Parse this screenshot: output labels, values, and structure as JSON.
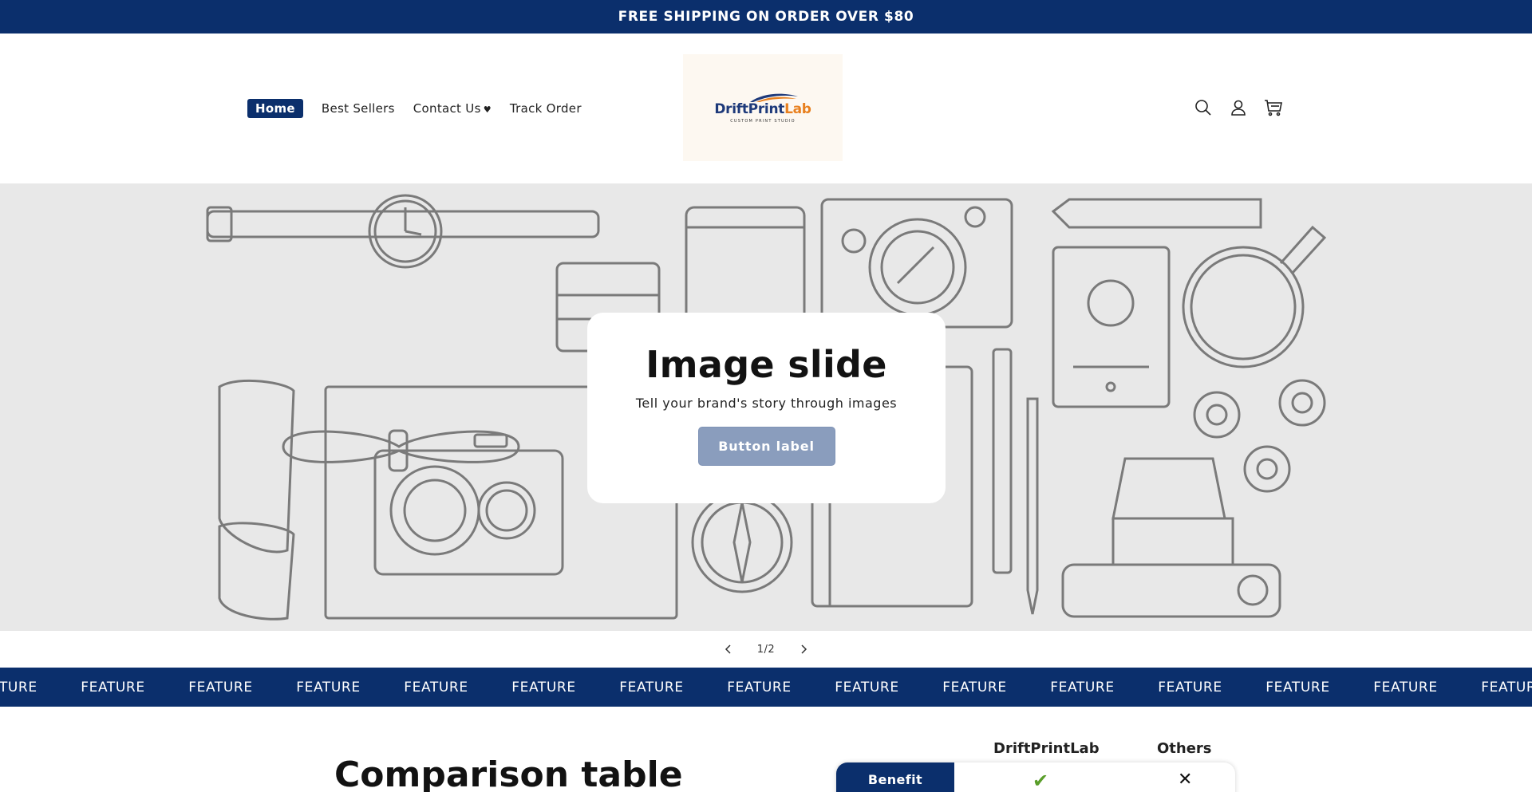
{
  "announcement": {
    "text": "FREE SHIPPING ON ORDER OVER $80"
  },
  "header": {
    "nav": [
      {
        "label": "Home",
        "active": true
      },
      {
        "label": "Best Sellers"
      },
      {
        "label": "Contact Us"
      },
      {
        "label": "Track Order"
      }
    ],
    "logo": {
      "word_primary": "DriftPrint",
      "word_accent": "Lab",
      "tagline": "CUSTOM PRINT STUDIO"
    },
    "icons": [
      "search-icon",
      "account-icon",
      "cart-icon"
    ]
  },
  "slideshow": {
    "title": "Image slide",
    "text": "Tell your brand's story through images",
    "button_label": "Button label",
    "counter": "1/2"
  },
  "marquee": {
    "item_label": "FEATURE",
    "items": [
      "FEATURE",
      "FEATURE",
      "FEATURE",
      "FEATURE",
      "FEATURE",
      "FEATURE",
      "FEATURE",
      "FEATURE",
      "FEATURE",
      "FEATURE",
      "FEATURE",
      "FEATURE",
      "FEATURE",
      "FEATURE",
      "FEATURE"
    ]
  },
  "comparison": {
    "heading": "Comparison table",
    "columns": [
      "DriftPrintLab",
      "Others"
    ],
    "rows": [
      {
        "label": "Benefit",
        "brand": "✔",
        "others": "✕"
      }
    ]
  },
  "colors": {
    "brand_navy": "#0b2f6c",
    "accent_orange": "#e8801f",
    "check_green": "#5a9e2a",
    "slide_bg": "#e8e8e8",
    "button_disabled": "#8a9dbd"
  }
}
